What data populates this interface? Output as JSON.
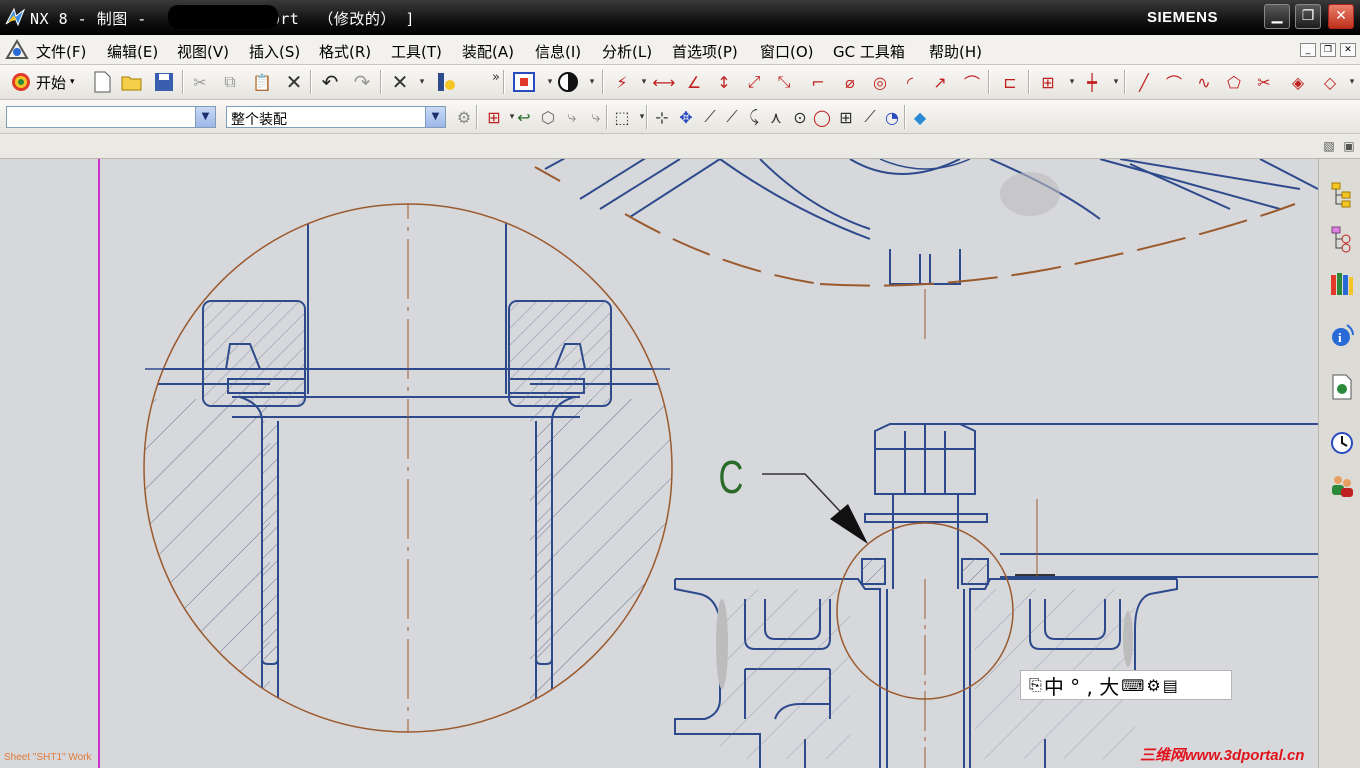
{
  "window": {
    "title": "NX 8 - 制图 -          00.prt  （修改的） ]",
    "brand": "SIEMENS",
    "minimize_label": "▁",
    "restore_label": "❐",
    "close_label": "✕"
  },
  "menu": {
    "items": [
      {
        "label": "文件(F)"
      },
      {
        "label": "编辑(E)"
      },
      {
        "label": "视图(V)"
      },
      {
        "label": "插入(S)"
      },
      {
        "label": "格式(R)"
      },
      {
        "label": "工具(T)"
      },
      {
        "label": "装配(A)"
      },
      {
        "label": "信息(I)"
      },
      {
        "label": "分析(L)"
      },
      {
        "label": "首选项(P)"
      },
      {
        "label": "窗口(O)"
      },
      {
        "label": "GC 工具箱"
      },
      {
        "label": "帮助(H)"
      }
    ]
  },
  "toolbar": {
    "start_label": "开始",
    "selection_filter_value": "",
    "assembly_scope_value": "整个装配",
    "overflow_label": "»"
  },
  "drawing": {
    "sheet_status": "Sheet \"SHT1\" Work",
    "detail_label": "C",
    "colors": {
      "background": "#d7d8dc",
      "geometry": "#2d4a8c",
      "detail_circle": "#9a5a2e",
      "border": "#cc33cc",
      "label": "#2a6a2a"
    }
  },
  "ime": {
    "text": "中 ° , 大"
  },
  "watermark": "三维网www.3dportal.cn"
}
